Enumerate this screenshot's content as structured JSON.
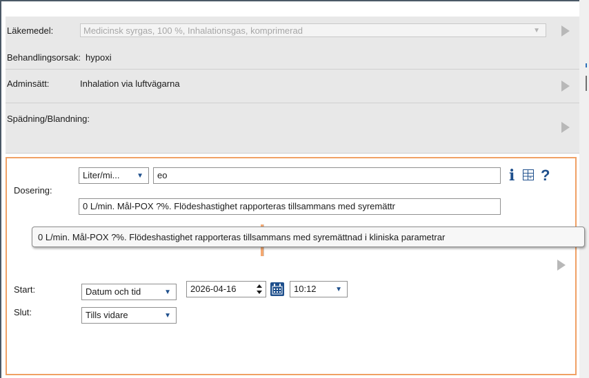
{
  "lakemedel": {
    "label": "Läkemedel:",
    "value": "Medicinsk syrgas, 100 %, Inhalationsgas, komprimerad"
  },
  "behandlingsorsak": {
    "label": "Behandlingsorsak:",
    "value": "hypoxi"
  },
  "adminsatt": {
    "label": "Adminsätt:",
    "value": "Inhalation via luftvägarna"
  },
  "spadning": {
    "label": "Spädning/Blandning:"
  },
  "dosering": {
    "label": "Dosering:",
    "unit_value": "Liter/mi...",
    "dose_value": "eo",
    "instruction_value": "0 L/min. Mål-POX ?%. Flödeshastighet rapporteras tillsammans med syremättr",
    "tooltip": "0 L/min. Mål-POX ?%. Flödeshastighet rapporteras tillsammans med syremättnad i kliniska parametrar"
  },
  "start": {
    "label": "Start:",
    "type_value": "Datum och tid",
    "date_value": "2026-04-16",
    "time_value": "10:12"
  },
  "slut": {
    "label": "Slut:",
    "type_value": "Tills vidare"
  },
  "icons": [
    "info-icon",
    "grid-icon",
    "help-icon",
    "calendar-icon",
    "arrow-right-icon"
  ],
  "colors": {
    "accent_blue": "#1e4f8c",
    "focus_orange": "#f0a064",
    "section_gray": "#e8e8e8"
  }
}
